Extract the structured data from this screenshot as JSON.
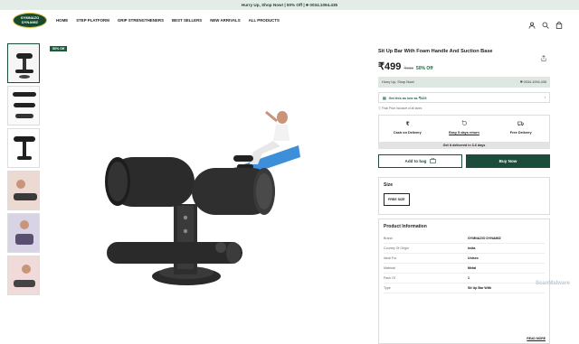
{
  "promo": {
    "text": "Hurry Up, Shop Now! | 50% Off | 🕿 0034.1094.435"
  },
  "brand": {
    "logo_line1": "GYMNAZO",
    "logo_line2": "DYNAMIZ"
  },
  "nav": {
    "items": [
      "HOME",
      "STEP PLATFORM",
      "GRIP STRENGTHENERS",
      "BEST SELLERS",
      "NEW ARRIVALS",
      "ALL PRODUCTS"
    ]
  },
  "header_icons": [
    "user-icon",
    "search-icon",
    "cart-icon"
  ],
  "gallery": {
    "badge": "50% Off"
  },
  "product": {
    "title": "Sit Up Bar With Foam Handle And Suction Base",
    "price": "₹499",
    "mrp": "₹999",
    "discount": "50% Off"
  },
  "hurry_bar": {
    "left": "Hurry Up, Shop Now!",
    "right": "🕿 0034.1094.435"
  },
  "offer": {
    "text": "Get this as low as ₹425"
  },
  "tax_note": "Final Price inclusive of all taxes",
  "features": [
    {
      "icon": "cash-icon",
      "label": "Cash on Delivery"
    },
    {
      "icon": "return-icon",
      "label": "Easy 5 days return"
    },
    {
      "icon": "truck-icon",
      "label": "Free Delivery"
    }
  ],
  "delivery_note": "Get it delivered in 3-6 days",
  "buttons": {
    "add_to_bag": "Add to bag",
    "buy_now": "Buy Now"
  },
  "size": {
    "label": "Size",
    "selected": "FREE SIZE"
  },
  "info": {
    "label": "Product Information",
    "rows": [
      {
        "k": "Brand",
        "v": "GYMNAZIO DYNAMIZ"
      },
      {
        "k": "Country Of Origin",
        "v": "India"
      },
      {
        "k": "Ideal For",
        "v": "Unisex"
      },
      {
        "k": "Material",
        "v": "Metal"
      },
      {
        "k": "Pack Of",
        "v": "1"
      },
      {
        "k": "Type",
        "v": "Sit Up Bar With"
      }
    ],
    "read_more": "READ MORE"
  },
  "watermark": "ScanMalware"
}
